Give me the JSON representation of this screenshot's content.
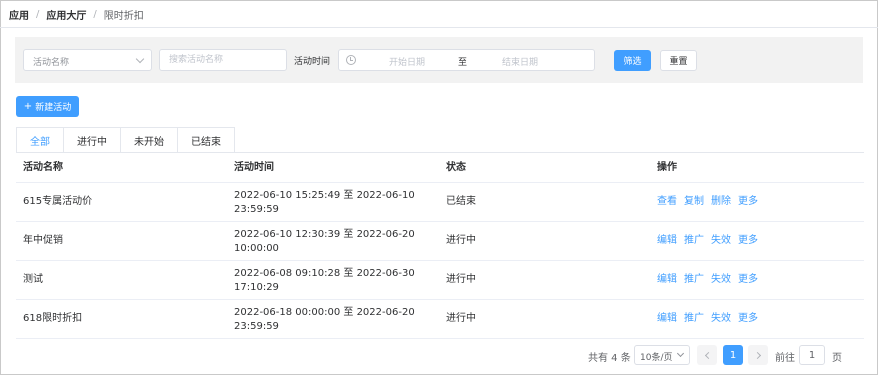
{
  "breadcrumb": {
    "root": "应用",
    "hall": "应用大厅",
    "current": "限时折扣",
    "sep": "/"
  },
  "filter": {
    "select_placeholder": "活动名称",
    "search_placeholder": "搜索活动名称",
    "time_label": "活动时间",
    "start_placeholder": "开始日期",
    "range_separator": "至",
    "end_placeholder": "结束日期",
    "filter_button": "筛选",
    "reset_button": "重置"
  },
  "toolbar": {
    "new_plus": "+",
    "new_button": "新建活动"
  },
  "tabs": [
    {
      "label": "全部",
      "active": true
    },
    {
      "label": "进行中"
    },
    {
      "label": "未开始"
    },
    {
      "label": "已结束"
    }
  ],
  "table": {
    "headers": [
      "活动名称",
      "活动时间",
      "状态",
      "操作"
    ],
    "rows": [
      {
        "name": "615专属活动价",
        "time": "2022-06-10 15:25:49 至 2022-06-10 23:59:59",
        "status": "已结束",
        "ops": [
          "查看",
          "复制",
          "删除",
          "更多"
        ]
      },
      {
        "name": "年中促销",
        "time": "2022-06-10 12:30:39 至 2022-06-20 10:00:00",
        "status": "进行中",
        "ops": [
          "编辑",
          "推广",
          "失效",
          "更多"
        ]
      },
      {
        "name": "测试",
        "time": "2022-06-08 09:10:28 至 2022-06-30 17:10:29",
        "status": "进行中",
        "ops": [
          "编辑",
          "推广",
          "失效",
          "更多"
        ]
      },
      {
        "name": "618限时折扣",
        "time": "2022-06-18 00:00:00 至 2022-06-20 23:59:59",
        "status": "进行中",
        "ops": [
          "编辑",
          "推广",
          "失效",
          "更多"
        ]
      }
    ]
  },
  "pagination": {
    "total": "共有 4 条",
    "page_size": "10条/页",
    "current_page": "1",
    "goto_label": "前往",
    "goto_value": "1",
    "page_unit": "页"
  },
  "colors": {
    "accent": "#409eff",
    "filter_bg": "#f2f2f2",
    "border": "#dcdfe6"
  }
}
